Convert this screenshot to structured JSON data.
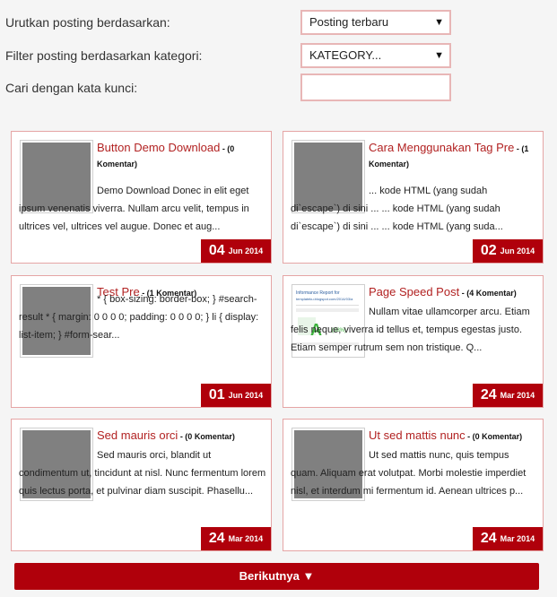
{
  "filters": {
    "sort_label": "Urutkan posting berdasarkan:",
    "sort_value": "Posting terbaru",
    "category_label": "Filter posting berdasarkan kategori:",
    "category_value": "KATEGORY...",
    "search_label": "Cari dengan kata kunci:",
    "search_value": ""
  },
  "posts": [
    {
      "title": "Button Demo Download",
      "comments": " - (0 Komentar)",
      "snippet": "Demo Download Donec in elit eget ipsum venenatis viverra. Nullam arcu velit, tempus in ultrices vel, ultrices vel augue. Donec et aug...",
      "day": "04",
      "month_year": "Jun 2014"
    },
    {
      "title": "Cara Menggunakan Tag Pre",
      "comments": " - (1 Komentar)",
      "snippet": "... kode HTML (yang sudah di`escape`) di sini ... ... kode HTML (yang sudah di`escape`) di sini ... ... kode HTML (yang suda...",
      "day": "02",
      "month_year": "Jun 2014"
    },
    {
      "title": "Test Pre",
      "comments": " - (1 Komentar)",
      "snippet": "* { box-sizing: border-box; } #search-result * { margin: 0 0 0 0; padding: 0 0 0 0; } li { display: list-item; } #form-sear...",
      "day": "01",
      "month_year": "Jun 2014"
    },
    {
      "title": "Page Speed Post",
      "comments": " - (4 Komentar)",
      "snippet": "Nullam vitae ullamcorper arcu. Etiam felis neque, viverra id tellus et, tempus egestas justo. Etiam semper rutrum sem non tristique. Q...",
      "day": "24",
      "month_year": "Mar 2014"
    },
    {
      "title": "Sed mauris orci",
      "comments": " - (0 Komentar)",
      "snippet": "Sed mauris orci, blandit ut condimentum ut, tincidunt at nisl. Nunc fermentum lorem quis lectus porta, et pulvinar diam suscipit. Phasellu...",
      "day": "24",
      "month_year": "Mar 2014"
    },
    {
      "title": "Ut sed mattis nunc",
      "comments": " - (0 Komentar)",
      "snippet": "Ut sed mattis nunc, quis tempus quam. Aliquam erat volutpat. Morbi molestie imperdiet nisl, et interdum mi fermentum id. Aenean ultrices p...",
      "day": "24",
      "month_year": "Mar 2014"
    }
  ],
  "pagespeed_thumb": {
    "heading": "Informance Report for",
    "site": "templateku.blogspot.com/2014/03/a",
    "grade": "A",
    "score": "(98%)"
  },
  "pagination": {
    "next_label": "Berikutnya",
    "next_icon": "triangle-down-icon"
  }
}
